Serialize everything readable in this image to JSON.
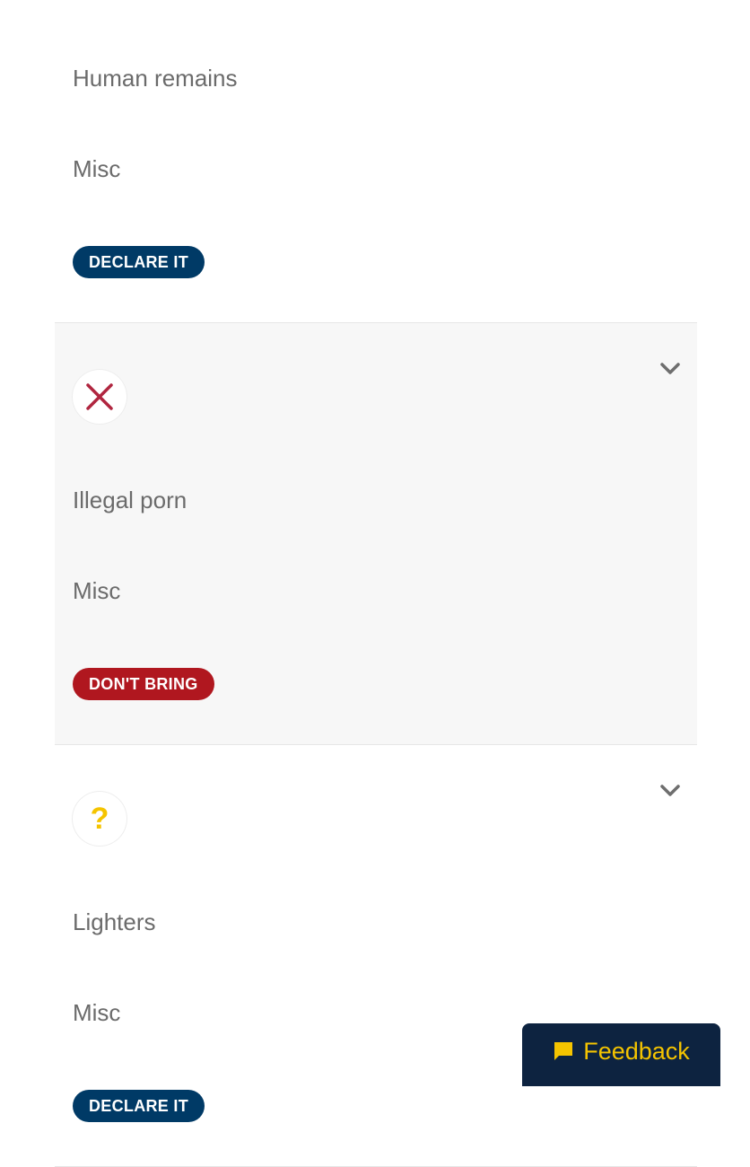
{
  "items": [
    {
      "name": "Human remains",
      "category": "Misc",
      "status": "declare",
      "status_label": "DECLARE IT",
      "status_icon": "question-mark-icon"
    },
    {
      "name": "Illegal porn",
      "category": "Misc",
      "status": "dont-bring",
      "status_label": "DON'T BRING",
      "status_icon": "cross-icon"
    },
    {
      "name": "Lighters",
      "category": "Misc",
      "status": "declare",
      "status_label": "DECLARE IT",
      "status_icon": "question-mark-icon"
    }
  ],
  "icons": {
    "question_mark": "?",
    "expand": "chevron-down-icon",
    "feedback": "speech-bubble-icon"
  },
  "feedback": {
    "label": "Feedback"
  },
  "colors": {
    "declare": "#003a66",
    "dont_bring": "#b0171f",
    "accent_yellow": "#f5c400",
    "cross_red": "#b0253f",
    "feedback_bg": "#0d2340"
  }
}
